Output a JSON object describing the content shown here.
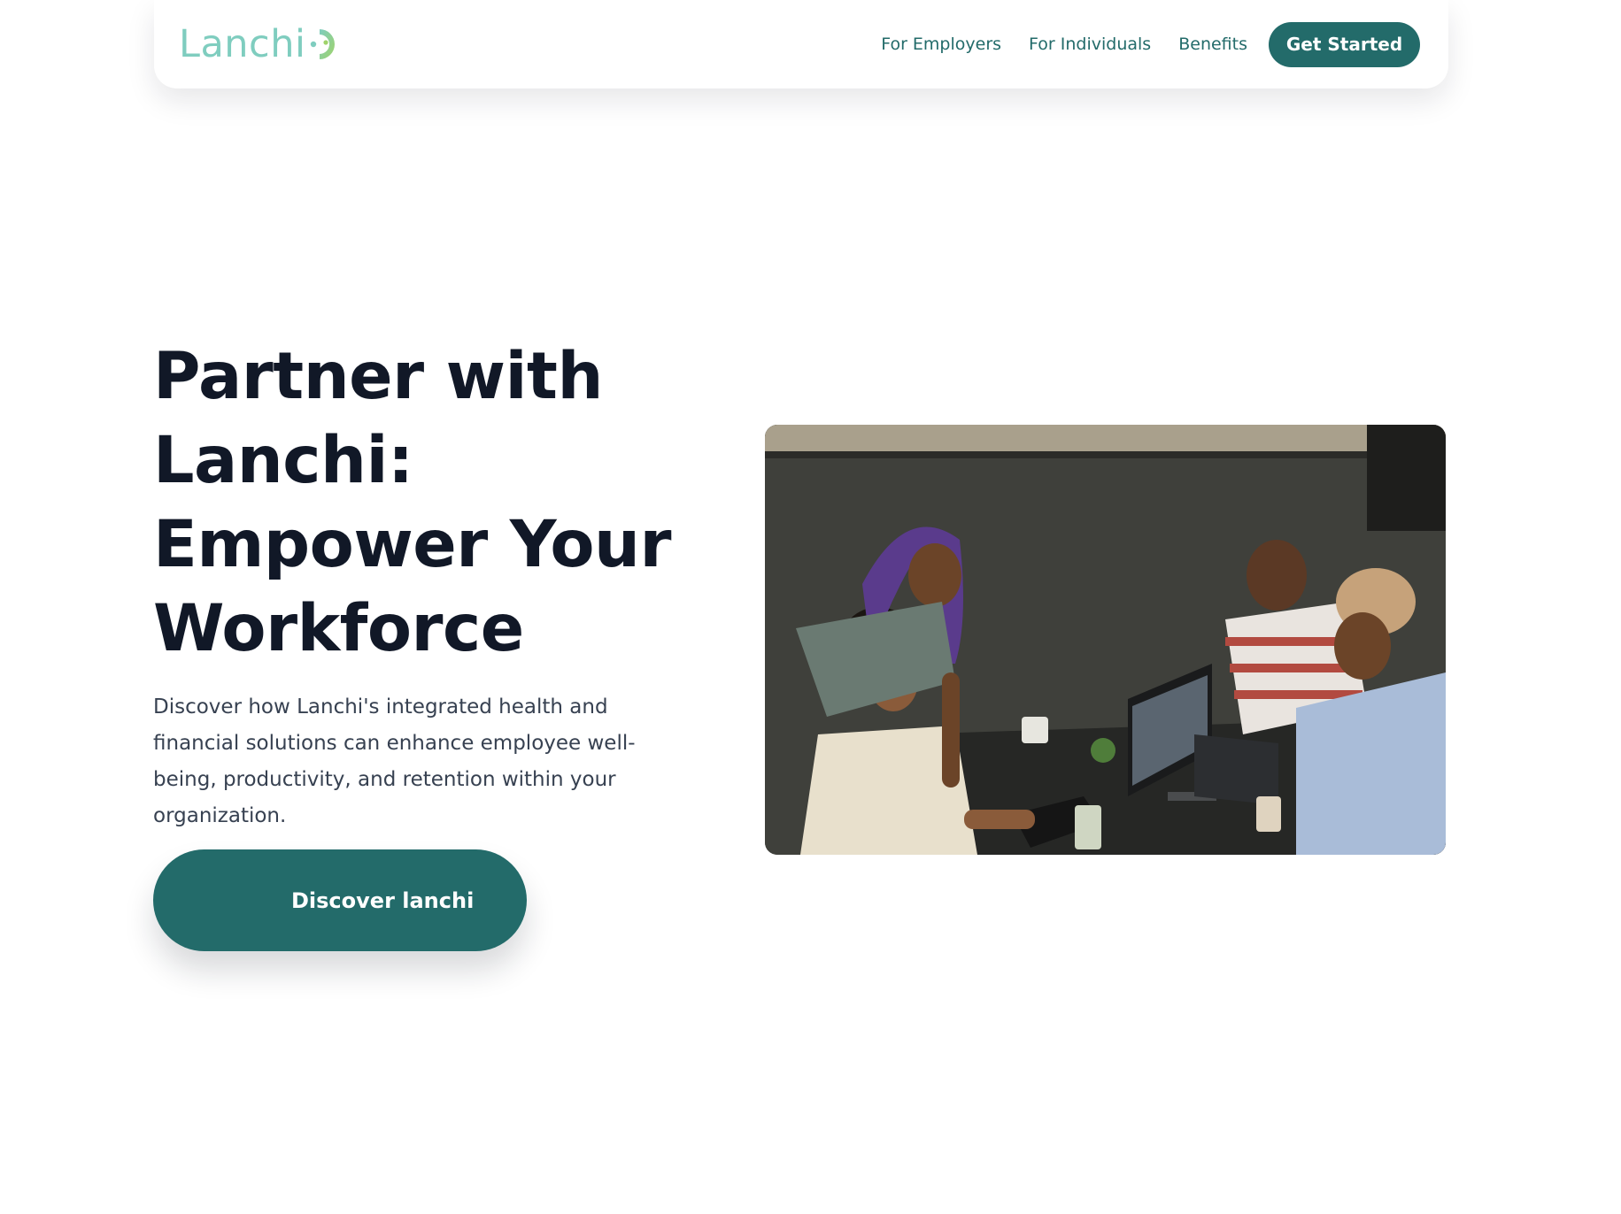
{
  "header": {
    "logo_text": "Lanchi",
    "nav": [
      {
        "label": "For Employers"
      },
      {
        "label": "For Individuals"
      },
      {
        "label": "Benefits"
      }
    ],
    "cta_label": "Get Started"
  },
  "hero": {
    "title_lines": [
      "Partner with",
      "Lanchi:",
      "Empower Your",
      "Workforce"
    ],
    "description": "Discover how Lanchi's integrated health and financial solutions can enhance employee well-being, productivity, and retention within your organization.",
    "cta_label": "Discover lanchi"
  },
  "colors": {
    "brand": "#236b6a",
    "logo": "#7fcdbf",
    "heading": "#111827",
    "body_text": "#374151"
  }
}
